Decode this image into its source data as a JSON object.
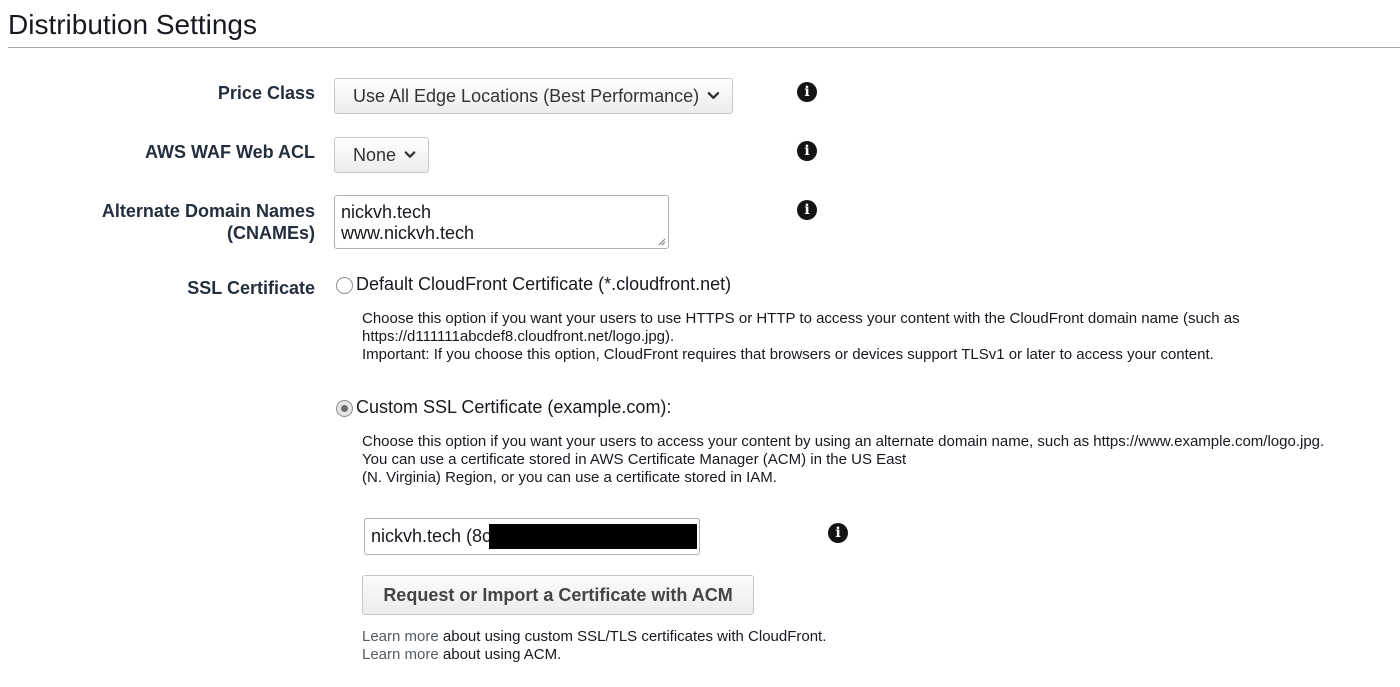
{
  "section": {
    "title": "Distribution Settings"
  },
  "price_class": {
    "label": "Price Class",
    "value": "Use All Edge Locations (Best Performance)",
    "info_icon": "info-circle-icon"
  },
  "waf": {
    "label": "AWS WAF Web ACL",
    "value": "None",
    "info_icon": "info-circle-icon"
  },
  "cnames": {
    "label_line1": "Alternate Domain Names",
    "label_line2": "(CNAMEs)",
    "lines": [
      "nickvh.tech",
      "www.nickvh.tech"
    ],
    "info_icon": "info-circle-icon"
  },
  "ssl": {
    "label": "SSL Certificate",
    "default_option": {
      "label": "Default CloudFront Certificate (*.cloudfront.net)",
      "checked": false,
      "desc_lines": [
        "Choose this option if you want your users to use HTTPS or HTTP to access your content with the CloudFront domain name (such as",
        "https://d111111abcdef8.cloudfront.net/logo.jpg).",
        "Important: If you choose this option, CloudFront requires that browsers or devices support TLSv1 or later to access your content."
      ]
    },
    "custom_option": {
      "label": "Custom SSL Certificate (example.com):",
      "checked": true,
      "desc_lines": [
        "Choose this option if you want your users to access your content by using an alternate domain name, such as https://www.example.com/logo.jpg.",
        "You can use a certificate stored in AWS Certificate Manager (ACM) in the US East",
        "(N. Virginia) Region, or you can use a certificate stored in IAM."
      ]
    },
    "certificate_value": "nickvh.tech (8c",
    "request_button": "Request or Import a Certificate with ACM",
    "links": [
      {
        "link": "Learn more",
        "text": " about using custom SSL/TLS certificates with CloudFront."
      },
      {
        "link": "Learn more",
        "text": " about using ACM."
      }
    ]
  },
  "colors": {
    "text": "#16191f",
    "label": "#232f3e",
    "link": "#545b64",
    "border": "#aab0b6"
  }
}
